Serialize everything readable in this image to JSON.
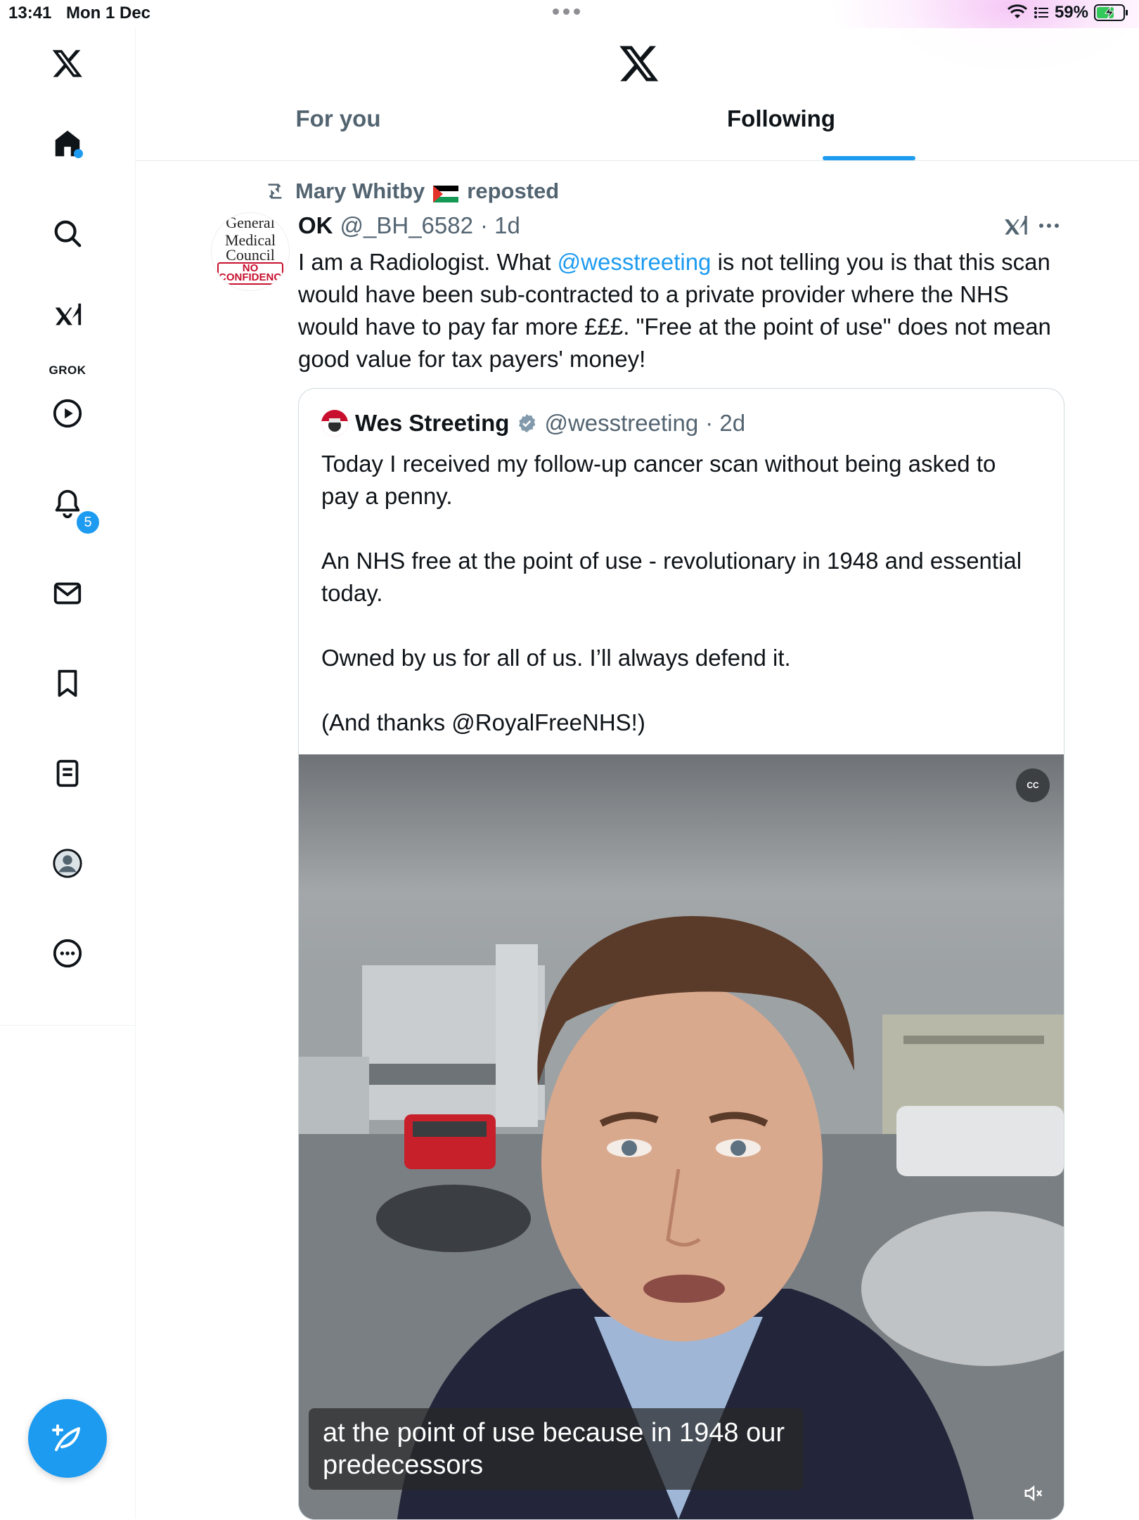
{
  "status_bar": {
    "time": "13:41",
    "date": "Mon 1 Dec",
    "battery": "59%"
  },
  "header": {
    "tabs": [
      {
        "label": "For you",
        "active": false
      },
      {
        "label": "Following",
        "active": true
      }
    ]
  },
  "sidebar": {
    "items": [
      {
        "name": "home",
        "icon": "home-icon"
      },
      {
        "name": "search",
        "icon": "search-icon"
      },
      {
        "name": "grok",
        "icon": "grok-icon",
        "label": "GROK"
      },
      {
        "name": "video",
        "icon": "play-icon"
      },
      {
        "name": "notifications",
        "icon": "bell-icon",
        "badge": "5"
      },
      {
        "name": "messages",
        "icon": "envelope-icon"
      },
      {
        "name": "bookmarks",
        "icon": "bookmark-icon"
      },
      {
        "name": "lists",
        "icon": "list-icon"
      },
      {
        "name": "profile",
        "icon": "avatar-icon"
      },
      {
        "name": "more",
        "icon": "more-circle-icon"
      }
    ]
  },
  "post": {
    "repost_by": "Mary Whitby",
    "repost_suffix": "reposted",
    "avatar_text": {
      "line1": "General",
      "line2": "Medical",
      "line3": "Council",
      "stamp": "NO CONFIDENCE"
    },
    "author_name": "OK",
    "author_handle": "@_BH_6582",
    "time": "· 1d",
    "text_before": "I am a Radiologist. What ",
    "mention": "@wesstreeting",
    "text_after": " is not telling you is that this scan would have been sub-contracted to a private provider where the NHS would have to pay far more £££. \"Free at the point of use\" does not mean good value for tax payers' money!"
  },
  "quote": {
    "author_name": "Wes Streeting",
    "author_handle": "@wesstreeting",
    "time": "· 2d",
    "text": "Today I received my follow-up cancer scan without being asked to pay a penny.\n\nAn NHS free at the point of use - revolutionary in 1948 and essential today.\n\nOwned by us for all of us. I’ll always defend it.\n\n(And thanks @RoyalFreeNHS!)",
    "video": {
      "caption": "at the point of use because in 1948 our predecessors",
      "cc_label": "CC"
    }
  },
  "colors": {
    "accent": "#1d9bf0",
    "text": "#0f1419",
    "muted": "#536471",
    "border": "#cfd9de"
  }
}
